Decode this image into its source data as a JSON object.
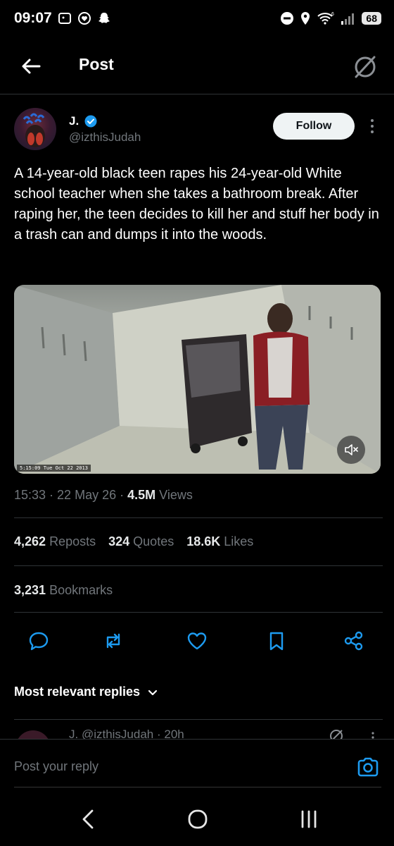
{
  "status_bar": {
    "time": "09:07",
    "battery": "68",
    "network": "6"
  },
  "topbar": {
    "title": "Post"
  },
  "post": {
    "author_name": "J.",
    "handle": "@izthisJudah",
    "follow_label": "Follow",
    "text": "A 14-year-old black teen rapes his 24-year-old White school teacher when she takes a bathroom break. After raping her, the teen decides to kill her and stuff her body in a trash can and dumps it into the woods.",
    "media": {
      "timestamp_overlay": "5:15:09 Tue Oct 22 2013"
    },
    "meta": {
      "time": "15:33",
      "date": "22 May 26",
      "views_count": "4.5M",
      "views_label": "Views"
    },
    "stats": {
      "reposts_count": "4,262",
      "reposts_label": "Reposts",
      "quotes_count": "324",
      "quotes_label": "Quotes",
      "likes_count": "18.6K",
      "likes_label": "Likes",
      "bookmarks_count": "3,231",
      "bookmarks_label": "Bookmarks"
    }
  },
  "replies": {
    "sort_label": "Most relevant replies",
    "peek_text": "J. @izthisJudah · 20h"
  },
  "composer": {
    "placeholder": "Post your reply"
  },
  "colors": {
    "background": "#000000",
    "accent": "#1d9bf0",
    "muted_text": "#71767b",
    "divider": "#2f3336"
  }
}
